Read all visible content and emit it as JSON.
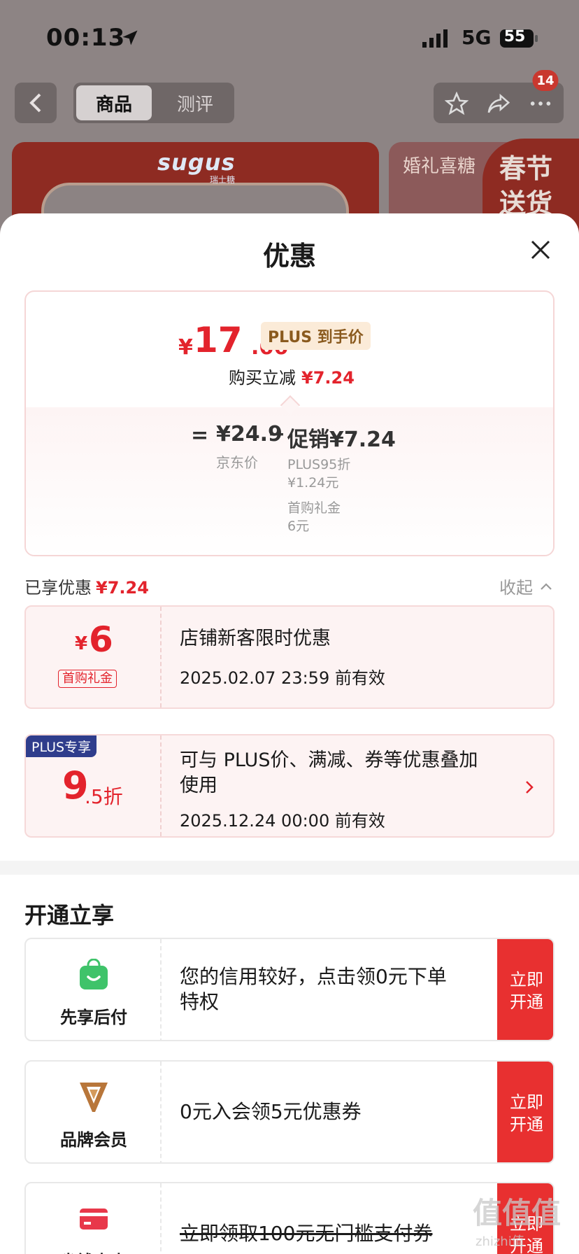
{
  "status_bar": {
    "time": "00:13",
    "network": "5G",
    "battery": "55"
  },
  "background_page": {
    "tabs": [
      "商品",
      "测评"
    ],
    "notification_count": "14",
    "banner_brand": "sugus",
    "banner_brand_sub": "瑞士糖",
    "banner_right_text": "婚礼喜糖",
    "spring_text": "春节送货"
  },
  "sheet": {
    "title": "优惠",
    "price": {
      "yen": "¥",
      "integer": "17",
      "decimal": ".66",
      "plus_label": "PLUS 到手价",
      "reduce_label": "购买立减",
      "reduce_amount": "¥7.24"
    },
    "breakdown": {
      "equals": "=",
      "jd_price": "¥24.9",
      "jd_label": "京东价",
      "minus": "−",
      "promo_main": "促销¥7.24",
      "promo_sub1_line1": "PLUS95折",
      "promo_sub1_line2": "¥1.24元",
      "promo_sub2_line1": "首购礼金",
      "promo_sub2_line2": "6元"
    },
    "enjoyed_label": "已享优惠",
    "enjoyed_amount": "¥7.24",
    "collapse_label": "收起",
    "coupons": [
      {
        "amount_yen": "¥",
        "amount": "6",
        "tag": "首购礼金",
        "title": "店铺新客限时优惠",
        "date": "2025.02.07 23:59 前有效"
      },
      {
        "corner": "PLUS专享",
        "amount": "9",
        "amount_suffix": ".5折",
        "title_line1": "可与 PLUS价、满减、券等优惠叠加",
        "title_line2": "使用",
        "date": "2025.12.24 00:00 前有效"
      }
    ],
    "open_section_title": "开通立享",
    "services": [
      {
        "name": "先享后付",
        "desc_line1": "您的信用较好，点击领0元下单",
        "desc_line2": "特权",
        "button_line1": "立即",
        "button_line2": "开通",
        "icon": "shopping-bag-icon",
        "icon_color": "#3fc36a"
      },
      {
        "name": "品牌会员",
        "desc_line1": "0元入会领5元优惠券",
        "button_line1": "立即",
        "button_line2": "开通",
        "icon": "v-logo-icon",
        "icon_color": "#b8763a"
      },
      {
        "name": "省钱卡点",
        "desc_line1": "立即领取100元无门槛支付券",
        "button_line1": "立即",
        "button_line2": "开通",
        "icon": "card-icon",
        "icon_color": "#e8384a"
      }
    ]
  },
  "watermark": {
    "main": "值值值",
    "sub": "zhizhi值"
  },
  "colors": {
    "accent_red": "#e3232c",
    "button_red": "#e83030",
    "plus_blue": "#2f3d8c"
  }
}
